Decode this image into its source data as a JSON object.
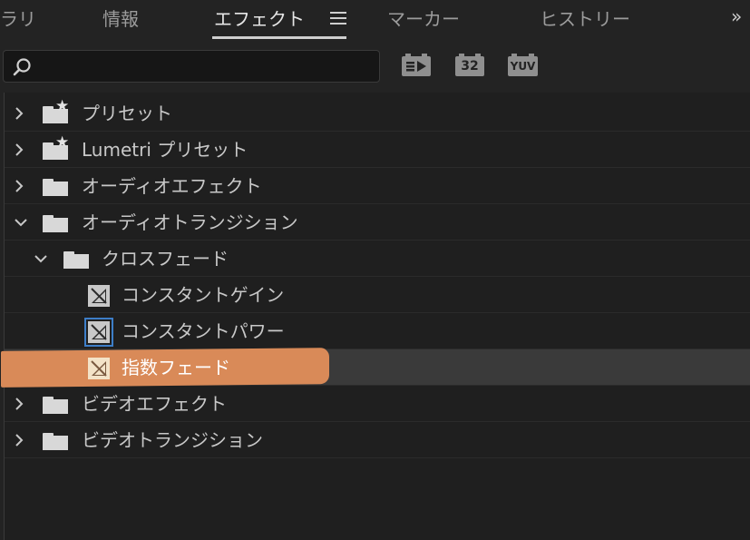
{
  "tabs": [
    {
      "label": "ラリ",
      "active": false
    },
    {
      "label": "情報",
      "active": false
    },
    {
      "label": "エフェクト",
      "active": true
    },
    {
      "label": "マーカー",
      "active": false
    },
    {
      "label": "ヒストリー",
      "active": false
    }
  ],
  "search": {
    "value": "",
    "placeholder": ""
  },
  "toolbar": {
    "accelerated_icon": "accelerated-effects-icon",
    "bit32_label": "32",
    "yuv_label": "YUV"
  },
  "tree": [
    {
      "label": "プリセット",
      "type": "preset-folder",
      "expanded": false,
      "level": 0
    },
    {
      "label": "Lumetri プリセット",
      "type": "preset-folder",
      "expanded": false,
      "level": 0
    },
    {
      "label": "オーディオエフェクト",
      "type": "folder",
      "expanded": false,
      "level": 0
    },
    {
      "label": "オーディオトランジション",
      "type": "folder",
      "expanded": true,
      "level": 0
    },
    {
      "label": "クロスフェード",
      "type": "folder",
      "expanded": true,
      "level": 1
    },
    {
      "label": "コンスタントゲイン",
      "type": "effect",
      "level": 2
    },
    {
      "label": "コンスタントパワー",
      "type": "effect",
      "level": 2,
      "framed": true
    },
    {
      "label": "指数フェード",
      "type": "effect",
      "level": 2,
      "selected": true
    },
    {
      "label": "ビデオエフェクト",
      "type": "folder",
      "expanded": false,
      "level": 0
    },
    {
      "label": "ビデオトランジション",
      "type": "folder",
      "expanded": false,
      "level": 0
    }
  ],
  "colors": {
    "background": "#232323",
    "highlight": "#d98a58",
    "framed_outline": "#3d7ec8"
  }
}
